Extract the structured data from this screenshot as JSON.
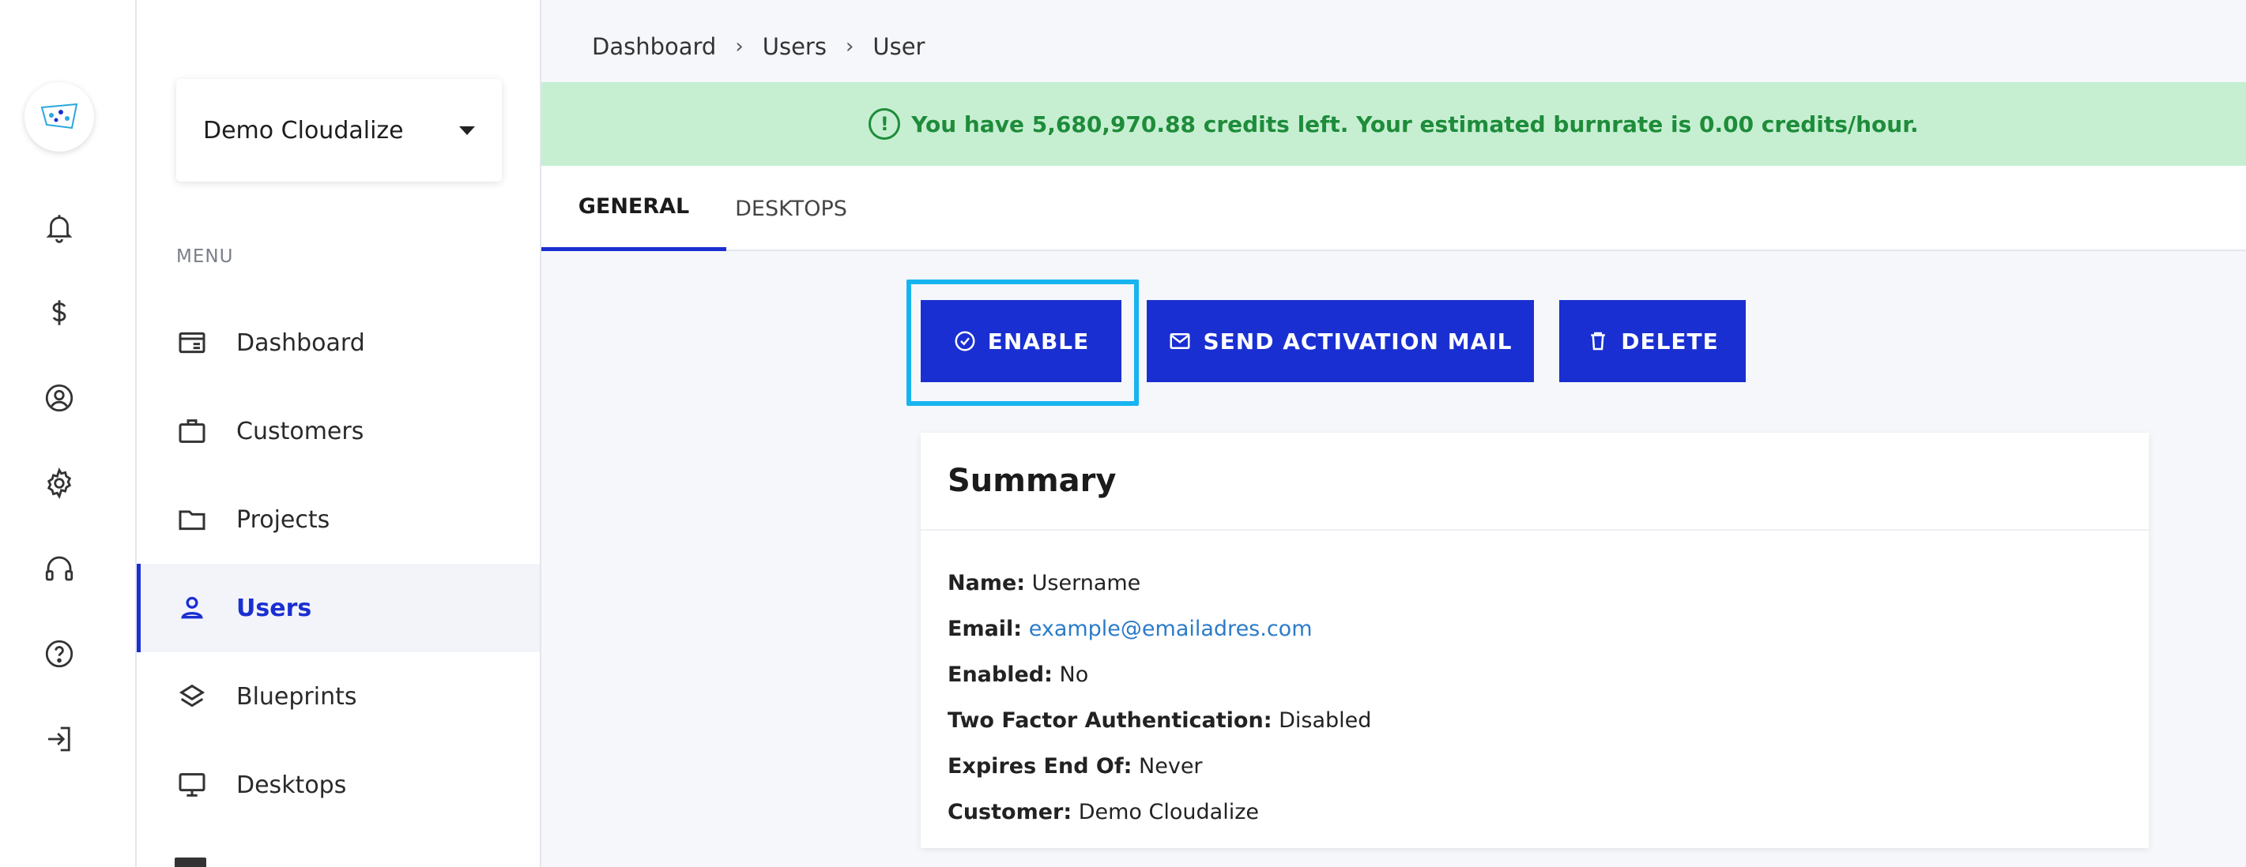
{
  "org_selector": {
    "label": "Demo Cloudalize"
  },
  "menu": {
    "title": "MENU",
    "items": [
      {
        "label": "Dashboard",
        "icon": "dashboard-icon"
      },
      {
        "label": "Customers",
        "icon": "briefcase-icon"
      },
      {
        "label": "Projects",
        "icon": "folder-icon"
      },
      {
        "label": "Users",
        "icon": "user-icon",
        "active": true
      },
      {
        "label": "Blueprints",
        "icon": "layers-icon"
      },
      {
        "label": "Desktops",
        "icon": "monitor-icon"
      }
    ]
  },
  "rail_icons": [
    "bell-icon",
    "dollar-icon",
    "account-circle-icon",
    "gear-icon",
    "headset-icon",
    "help-icon",
    "logout-icon"
  ],
  "breadcrumb": [
    "Dashboard",
    "Users",
    "User"
  ],
  "banner": {
    "text": "You have 5,680,970.88 credits left. Your estimated burnrate is 0.00 credits/hour.",
    "icon": "exclamation-circle-icon"
  },
  "tabs": [
    {
      "label": "GENERAL",
      "active": true
    },
    {
      "label": "DESKTOPS",
      "active": false
    }
  ],
  "actions": {
    "enable": "ENABLE",
    "send_activation": "SEND ACTIVATION MAIL",
    "delete": "DELETE"
  },
  "summary": {
    "title": "Summary",
    "fields": [
      {
        "label": "Name:",
        "value": "Username"
      },
      {
        "label": "Email:",
        "value": "example@emailadres.com"
      },
      {
        "label": "Enabled:",
        "value": "No"
      },
      {
        "label": "Two Factor Authentication:",
        "value": "Disabled"
      },
      {
        "label": "Expires End Of:",
        "value": "Never"
      },
      {
        "label": "Customer:",
        "value": "Demo Cloudalize"
      }
    ]
  },
  "colors": {
    "primary": "#1a2fd1",
    "banner_bg": "#c6efd2",
    "banner_text": "#1e8c3a",
    "highlight": "#18b4f0",
    "link": "#2c7bc9"
  }
}
